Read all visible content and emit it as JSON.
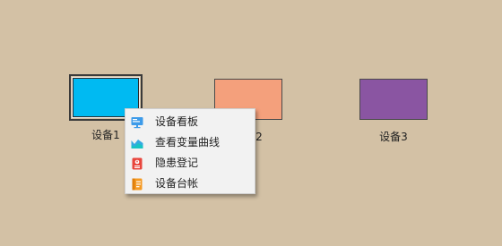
{
  "devices": [
    {
      "label": "设备1",
      "color": "#00baf2",
      "selected": true
    },
    {
      "label": "设备2",
      "color": "#f4a07c",
      "selected": false
    },
    {
      "label": "设备3",
      "color": "#8a55a2",
      "selected": false
    }
  ],
  "context_menu": {
    "items": [
      {
        "label": "设备看板",
        "icon": "dashboard-monitor-icon"
      },
      {
        "label": "查看变量曲线",
        "icon": "area-chart-icon"
      },
      {
        "label": "隐患登记",
        "icon": "hazard-register-icon"
      },
      {
        "label": "设备台帐",
        "icon": "ledger-icon"
      }
    ]
  }
}
